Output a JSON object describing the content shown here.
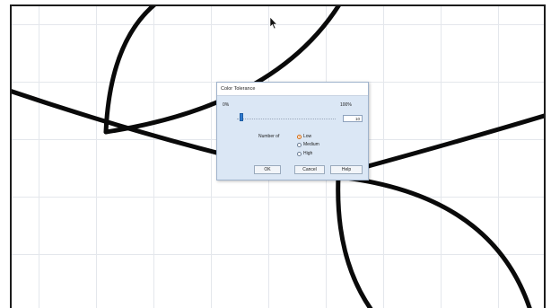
{
  "dialog": {
    "title": "Color Tolerance",
    "slider": {
      "min_label": "0%",
      "max_label": "100%",
      "value": "10",
      "level_fraction": 0.1
    },
    "number_of_label": "Number of",
    "radio_options": [
      {
        "label": "Low",
        "selected": true
      },
      {
        "label": "Medium",
        "selected": false
      },
      {
        "label": "High",
        "selected": false
      }
    ],
    "buttons": {
      "ok": "OK",
      "cancel": "Cancel",
      "help": "Help"
    }
  },
  "colors": {
    "stroke": "#0a0a0a",
    "grid": "#e4e7ec",
    "dialog_bg": "#dbe7f5",
    "accent": "#2f7ad0"
  }
}
